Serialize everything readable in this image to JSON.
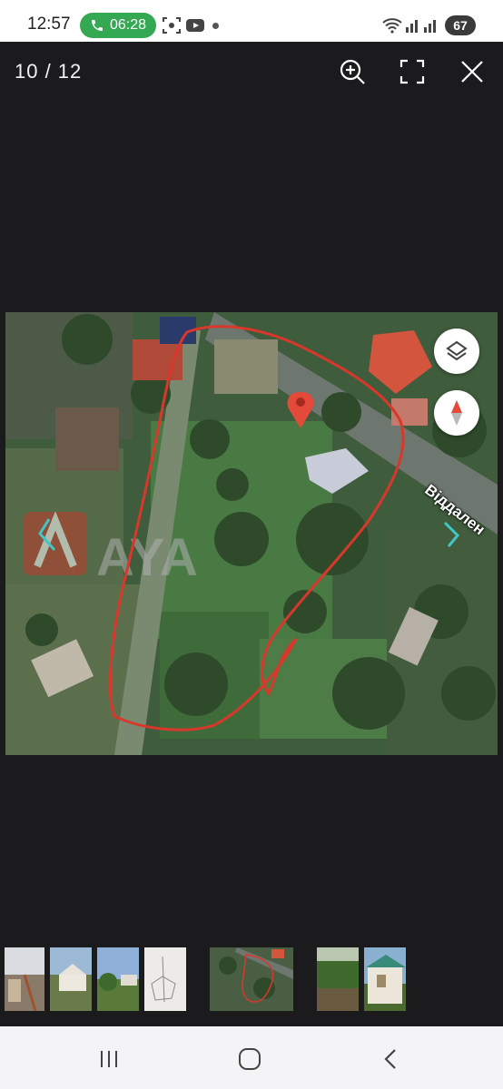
{
  "status_bar": {
    "time": "12:57",
    "call_timer": "06:28",
    "battery": "67",
    "icons": [
      "phone-icon",
      "screen-record-icon",
      "youtube-icon",
      "dot-icon",
      "wifi-icon",
      "signal-icon",
      "signal-icon",
      "battery-icon"
    ]
  },
  "viewer": {
    "counter": "10 / 12",
    "buttons": [
      "zoom-in-icon",
      "fullscreen-icon",
      "close-icon"
    ]
  },
  "image": {
    "street_label": "Віддален",
    "watermark": "AYA",
    "map_controls": [
      "layers-icon",
      "compass-icon"
    ],
    "accent_colors": {
      "boundary": "#d8382b",
      "pin": "#e5493a",
      "house_roof": "#c94a34"
    }
  },
  "thumbnails": {
    "count": 8,
    "selected_index": 4
  },
  "nav_bar": {
    "buttons": [
      "recent-apps-icon",
      "home-icon",
      "back-icon"
    ]
  }
}
